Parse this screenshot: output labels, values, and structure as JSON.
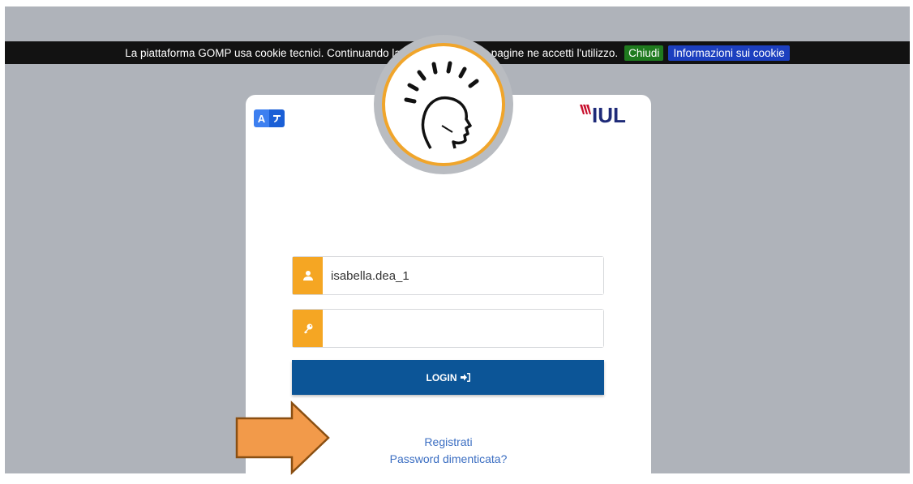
{
  "cookie_banner": {
    "message": "La piattaforma GOMP usa cookie tecnici. Continuando la navigazione nelle pagine ne accetti l'utilizzo.",
    "close_label": "Chiudi",
    "info_label": "Informazioni sui cookie"
  },
  "login_card": {
    "lang_letter": "A",
    "logo_text": "IUL",
    "username_value": "isabella.dea_1",
    "password_value": "",
    "login_label": "LOGIN",
    "register_label": "Registrati",
    "forgot_label": "Password dimenticata?"
  },
  "colors": {
    "backdrop": "#afb3ba",
    "accent_orange": "#f5a623",
    "login_blue": "#0c5597",
    "link_blue": "#3b6ec2",
    "logo_red": "#c8102e",
    "logo_navy": "#1e2a78"
  },
  "icons": [
    "user-icon",
    "key-icon",
    "sign-in-icon",
    "head-avatar-icon",
    "translate-icon",
    "arrow-annotation"
  ]
}
